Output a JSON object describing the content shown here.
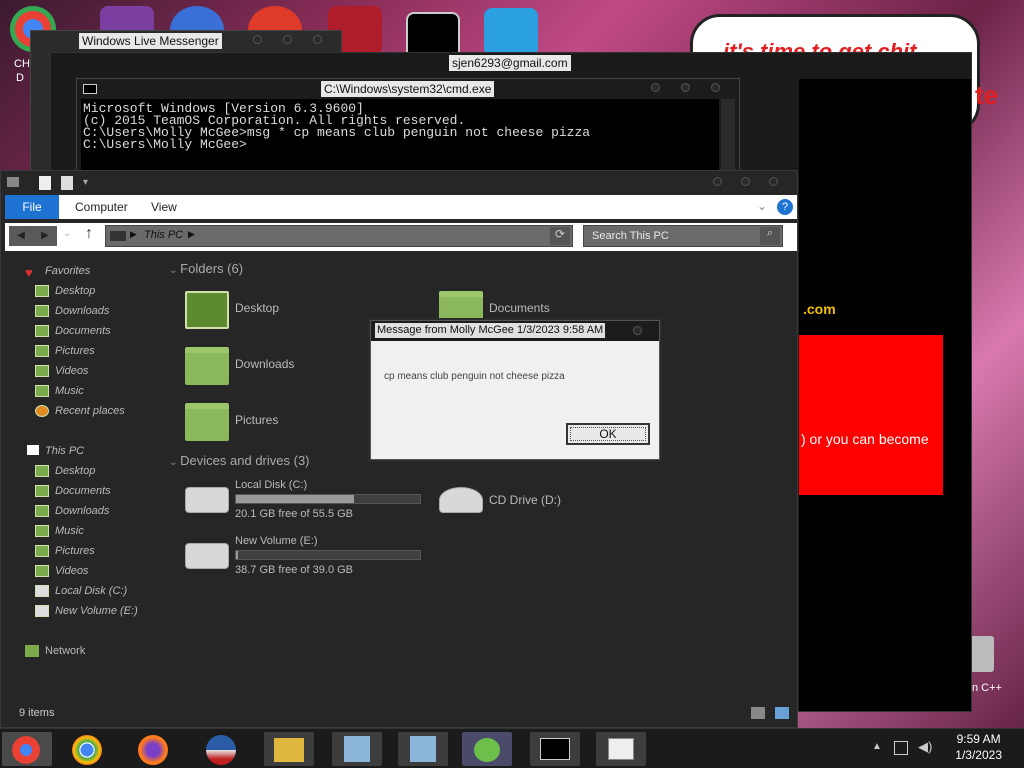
{
  "desktop": {
    "banner_text": "it's time to get chit",
    "side_text_1": "CH",
    "side_text_2": "D",
    "side_text_3": "te",
    "side_text_4": "n C++"
  },
  "messenger": {
    "title": "Windows Live Messenger"
  },
  "chat": {
    "title": "sjen6293@gmail.com",
    "link_text": ".com",
    "red_text": ") or you can become"
  },
  "cmd": {
    "title": "C:\\Windows\\system32\\cmd.exe",
    "lines": [
      "Microsoft Windows [Version 6.3.9600]",
      "(c) 2015 TeamOS Corporation. All rights reserved.",
      "",
      "C:\\Users\\Molly McGee>msg * cp means club penguin not cheese pizza",
      "",
      "C:\\Users\\Molly McGee>"
    ]
  },
  "explorer": {
    "tabs": [
      "File",
      "Computer",
      "View"
    ],
    "address": "This PC",
    "search_placeholder": "Search This PC",
    "sidebar": {
      "favorites_label": "Favorites",
      "favorites": [
        "Desktop",
        "Downloads",
        "Documents",
        "Pictures",
        "Videos",
        "Music",
        "Recent places"
      ],
      "thispc_label": "This PC",
      "thispc": [
        "Desktop",
        "Documents",
        "Downloads",
        "Music",
        "Pictures",
        "Videos",
        "Local Disk (C:)",
        "New Volume (E:)"
      ],
      "network_label": "Network"
    },
    "folders_header": "Folders (6)",
    "folders": [
      "Desktop",
      "Documents",
      "Downloads",
      "Pictures"
    ],
    "devices_header": "Devices and drives (3)",
    "drives": [
      {
        "name": "Local Disk (C:)",
        "free": "20.1 GB free of 55.5 GB",
        "used_fraction": 0.64
      },
      {
        "name": "New Volume (E:)",
        "free": "38.7 GB free of 39.0 GB",
        "used_fraction": 0.01
      },
      {
        "name": "CD Drive (D:)"
      }
    ],
    "status": "9 items"
  },
  "message": {
    "title": "Message from Molly McGee 1/3/2023 9:58 AM",
    "text": "cp means club penguin not cheese pizza",
    "ok": "OK"
  },
  "taskbar": {
    "time": "9:59 AM",
    "date": "1/3/2023",
    "apps": [
      "chrome-legacy-icon",
      "chrome-icon",
      "firefox-icon",
      "obama-logo-icon",
      "file-explorer-icon",
      "network-setup-icon",
      "network-setup-2-icon",
      "messenger-icon",
      "cmd-icon",
      "window-app-icon"
    ]
  },
  "colors": {
    "accent_blue": "#1e73d2",
    "folder_green": "#8bb85c",
    "chat_red": "#ff0000"
  }
}
